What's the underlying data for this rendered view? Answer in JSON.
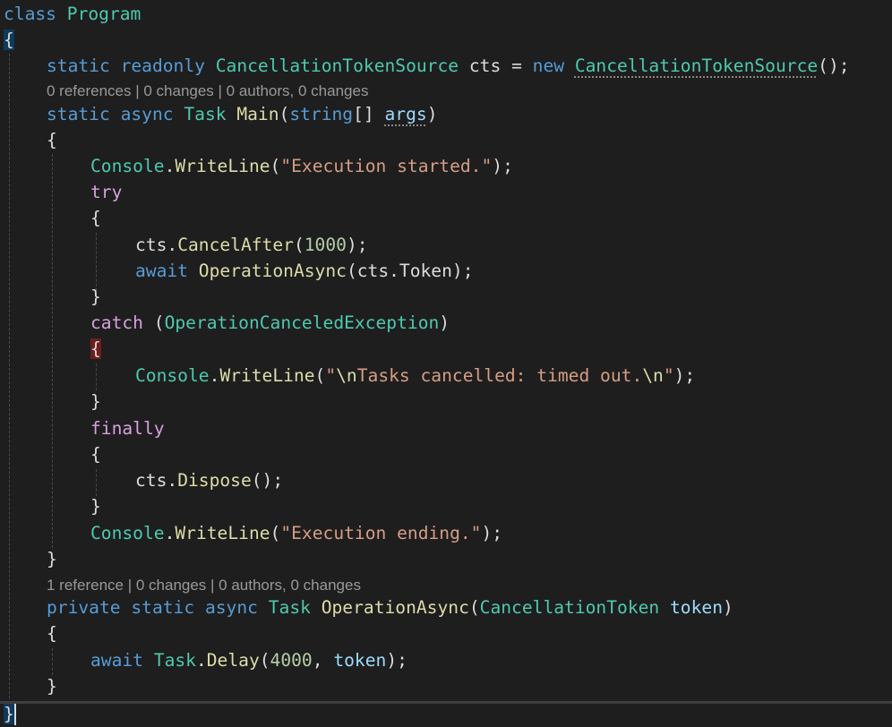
{
  "code": {
    "class_keyword": "class",
    "class_name": "Program",
    "open_brace": "{",
    "close_brace": "}",
    "line_field": {
      "static": "static",
      "readonly": "readonly",
      "type": "CancellationTokenSource",
      "name": " cts ",
      "eq": "= ",
      "new": "new",
      "ctor": "CancellationTokenSource",
      "end": "();"
    },
    "lens_main": "0 references | 0 changes | 0 authors, 0 changes",
    "line_main": {
      "static": "static",
      "async": "async",
      "task": "Task",
      "name": "Main",
      "open": "(",
      "string": "string",
      "arr": "[] ",
      "args": "args",
      "close": ")"
    },
    "brace_open": "{",
    "brace_close": "}",
    "writeline_start": {
      "console": "Console",
      "dot": ".",
      "method": "WriteLine",
      "open": "(",
      "text": "\"Execution started.\"",
      "close": ");"
    },
    "try_keyword": "try",
    "cancel_after": {
      "obj": "cts",
      "dot": ".",
      "method": "CancelAfter",
      "open": "(",
      "num": "1000",
      "close": ");"
    },
    "await_op": {
      "await": "await",
      "method": "OperationAsync",
      "open": "(",
      "arg": "cts",
      "dot": ".",
      "prop": "Token",
      "close": ");"
    },
    "catch_line": {
      "catch": "catch",
      "open": " (",
      "type": "OperationCanceledException",
      "close": ")"
    },
    "writeline_cancel": {
      "console": "Console",
      "dot": ".",
      "method": "WriteLine",
      "open": "(",
      "q1": "\"",
      "esc1": "\\n",
      "text": "Tasks cancelled: timed out.",
      "esc2": "\\n",
      "q2": "\"",
      "close": ");"
    },
    "finally_keyword": "finally",
    "dispose": {
      "obj": "cts",
      "dot": ".",
      "method": "Dispose",
      "close": "();"
    },
    "writeline_end": {
      "console": "Console",
      "dot": ".",
      "method": "WriteLine",
      "open": "(",
      "text": "\"Execution ending.\"",
      "close": ");"
    },
    "lens_op": "1 reference | 0 changes | 0 authors, 0 changes",
    "line_op": {
      "private": "private",
      "static": "static",
      "async": "async",
      "task": "Task",
      "name": "OperationAsync",
      "open": "(",
      "ptype": "CancellationToken",
      "pname": "token",
      "close": ")"
    },
    "await_delay": {
      "await": "await",
      "task": "Task",
      "dot": ".",
      "method": "Delay",
      "open": "(",
      "num": "4000",
      "comma": ", ",
      "arg": "token",
      "close": ");"
    }
  }
}
